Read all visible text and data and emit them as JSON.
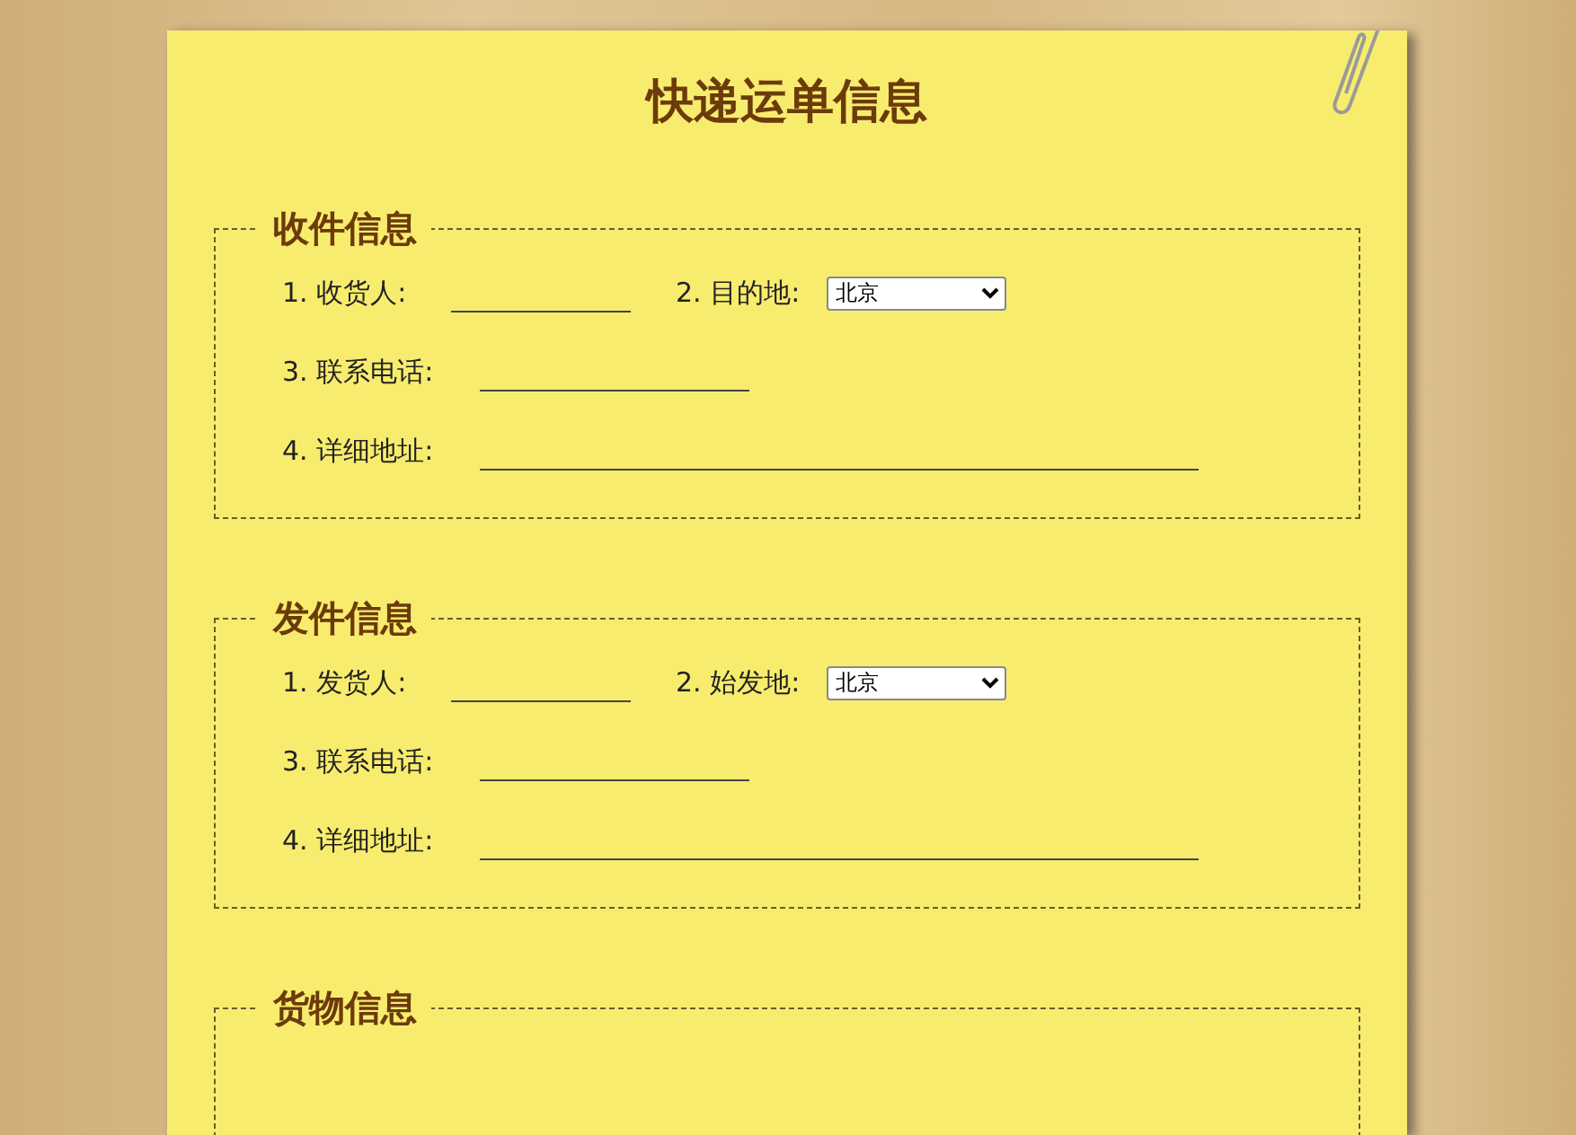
{
  "title": "快递运单信息",
  "sections": [
    {
      "legend": "收件信息",
      "rows": [
        [
          {
            "kind": "text",
            "label": "1. 收货人:"
          },
          {
            "kind": "select",
            "label": "2. 目的地:",
            "value": "北京"
          }
        ],
        [
          {
            "kind": "text",
            "label": "3. 联系电话:"
          }
        ],
        [
          {
            "kind": "text",
            "label": "4. 详细地址:"
          }
        ]
      ]
    },
    {
      "legend": "发件信息",
      "rows": [
        [
          {
            "kind": "text",
            "label": "1. 发货人:"
          },
          {
            "kind": "select",
            "label": "2. 始发地:",
            "value": "北京"
          }
        ],
        [
          {
            "kind": "text",
            "label": "3. 联系电话:"
          }
        ],
        [
          {
            "kind": "text",
            "label": "4. 详细地址:"
          }
        ]
      ]
    },
    {
      "legend": "货物信息"
    }
  ]
}
